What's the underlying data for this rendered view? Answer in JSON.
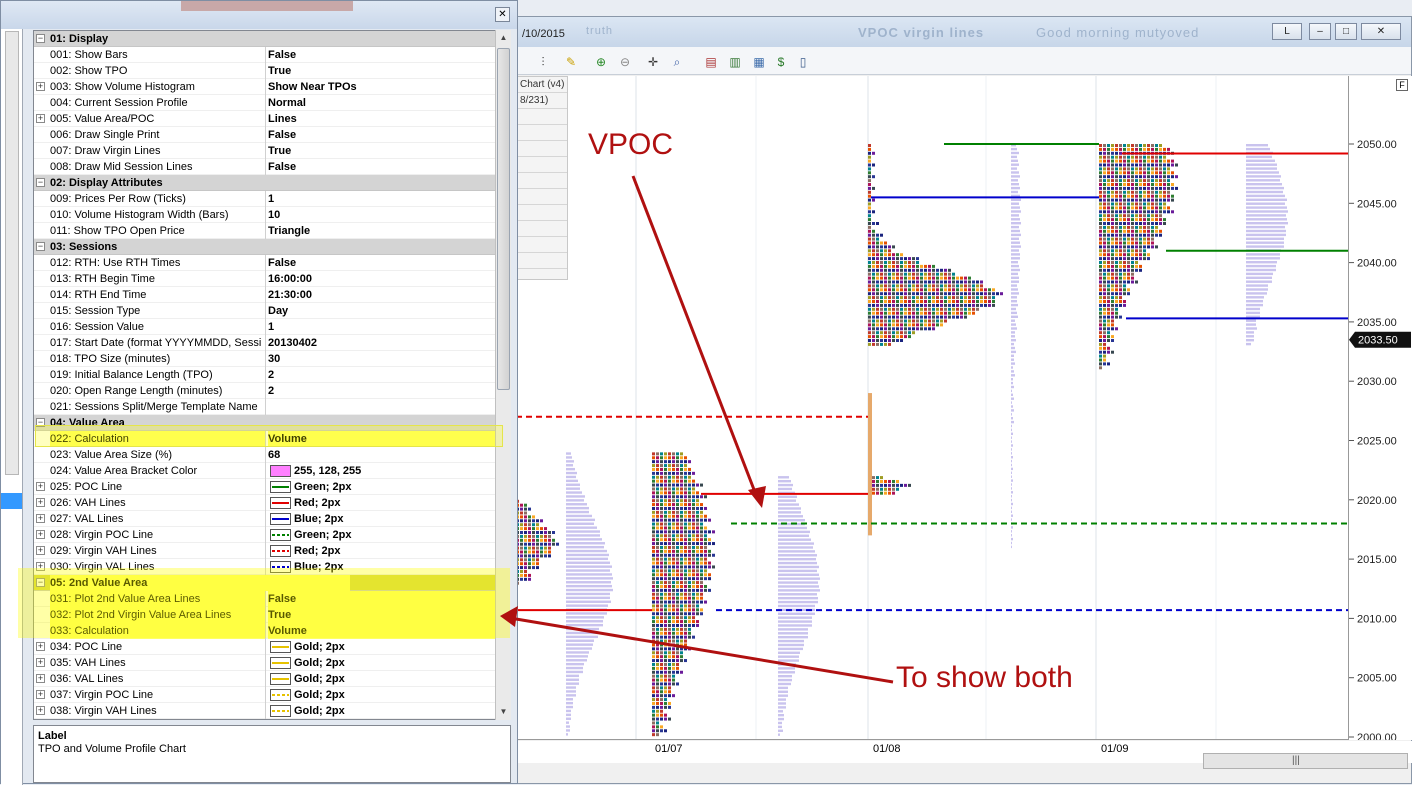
{
  "chart_window": {
    "date_fragment": "/10/2015",
    "title_blur": "VPOC virgin lines",
    "title_blur_extra": "Good morning mutyoved",
    "title_left_blur": "truth",
    "btn_l": "L",
    "btn_min": "–",
    "btn_max": "□",
    "btn_close": "✕",
    "f_button": "F",
    "info_panel": [
      "Chart (v4)",
      "8/231)",
      "",
      "",
      "",
      "",
      "",
      "",
      "",
      "",
      "",
      ""
    ],
    "price_axis": {
      "ticks": [
        "2050.00",
        "2045.00",
        "2040.00",
        "2035.00",
        "2030.00",
        "2025.00",
        "2020.00",
        "2015.00",
        "2010.00",
        "2005.00",
        "2000.00"
      ],
      "current_price": "2033.50"
    },
    "time_axis": [
      "01/07",
      "01/08",
      "01/09"
    ],
    "scroll_grip": "|||"
  },
  "properties": {
    "close_label": "✕",
    "rows": [
      {
        "type": "cat",
        "exp": "⊟",
        "name": "01: Display"
      },
      {
        "name": "001: Show Bars",
        "val": "False"
      },
      {
        "name": "002: Show TPO",
        "val": "True"
      },
      {
        "exp": "+",
        "name": "003: Show Volume Histogram",
        "val": "Show Near TPOs"
      },
      {
        "name": "004: Current Session Profile",
        "val": "Normal"
      },
      {
        "exp": "+",
        "name": "005: Value Area/POC",
        "val": "Lines"
      },
      {
        "name": "006: Draw Single Print",
        "val": "False"
      },
      {
        "name": "007: Draw Virgin Lines",
        "val": "True"
      },
      {
        "name": "008: Draw Mid Session Lines",
        "val": "False"
      },
      {
        "type": "cat",
        "exp": "⊟",
        "name": "02: Display Attributes"
      },
      {
        "name": "009: Prices Per Row (Ticks)",
        "val": "1"
      },
      {
        "name": "010: Volume Histogram Width (Bars)",
        "val": "10"
      },
      {
        "name": "011: Show TPO Open Price",
        "val": "Triangle"
      },
      {
        "type": "cat",
        "exp": "⊟",
        "name": "03: Sessions"
      },
      {
        "name": "012: RTH: Use RTH Times",
        "val": "False"
      },
      {
        "name": "013: RTH Begin Time",
        "val": "16:00:00"
      },
      {
        "name": "014: RTH End Time",
        "val": "21:30:00"
      },
      {
        "name": "015: Session Type",
        "val": "Day"
      },
      {
        "name": "016: Session Value",
        "val": "1"
      },
      {
        "name": "017: Start Date (format YYYYMMDD, Sessi",
        "val": "20130402"
      },
      {
        "name": "018: TPO Size (minutes)",
        "val": "30"
      },
      {
        "name": "019: Initial Balance Length (TPO)",
        "val": "2"
      },
      {
        "name": "020: Open Range Length (minutes)",
        "val": "2"
      },
      {
        "name": "021: Sessions Split/Merge Template Name",
        "val": ""
      },
      {
        "type": "cat",
        "exp": "⊟",
        "name": "04: Value Area"
      },
      {
        "name": "022: Calculation",
        "val": "Volume",
        "hl": true
      },
      {
        "name": "023: Value Area Size (%)",
        "val": "68"
      },
      {
        "name": "024: Value Area Bracket Color",
        "val": "255, 128, 255",
        "swatch": "#ff80ff",
        "fill": true
      },
      {
        "exp": "+",
        "name": "025: POC Line",
        "val": "Green; 2px",
        "swatch": "#008000"
      },
      {
        "exp": "+",
        "name": "026: VAH Lines",
        "val": "Red; 2px",
        "swatch": "#e00000"
      },
      {
        "exp": "+",
        "name": "027: VAL Lines",
        "val": "Blue; 2px",
        "swatch": "#0000cc"
      },
      {
        "exp": "+",
        "name": "028: Virgin POC Line",
        "val": "Green; 2px",
        "swatch": "#008000",
        "dashed": true
      },
      {
        "exp": "+",
        "name": "029: Virgin VAH Lines",
        "val": "Red; 2px",
        "swatch": "#e00000",
        "dashed": true
      },
      {
        "exp": "+",
        "name": "030: Virgin VAL Lines",
        "val": "Blue; 2px",
        "swatch": "#0000cc",
        "dashed": true
      },
      {
        "type": "cat",
        "exp": "⊟",
        "name": "05: 2nd Value Area",
        "hl": true
      },
      {
        "name": "031: Plot 2nd Value Area Lines",
        "val": "False",
        "hl": true
      },
      {
        "name": "032: Plot 2nd Virgin Value Area Lines",
        "val": "True",
        "hl": true
      },
      {
        "name": "033: Calculation",
        "val": "Volume",
        "hl": true
      },
      {
        "exp": "+",
        "name": "034: POC Line",
        "val": "Gold; 2px",
        "swatch": "#e6c200"
      },
      {
        "exp": "+",
        "name": "035: VAH Lines",
        "val": "Gold; 2px",
        "swatch": "#e6c200"
      },
      {
        "exp": "+",
        "name": "036: VAL Lines",
        "val": "Gold; 2px",
        "swatch": "#e6c200"
      },
      {
        "exp": "+",
        "name": "037: Virgin POC Line",
        "val": "Gold; 2px",
        "swatch": "#e6c200",
        "dashed": true
      },
      {
        "exp": "+",
        "name": "038: Virgin VAH Lines",
        "val": "Gold; 2px",
        "swatch": "#e6c200",
        "dashed": true
      }
    ],
    "description": {
      "title": "Label",
      "text": "TPO and Volume Profile Chart"
    }
  },
  "annotations": {
    "vpoc": "VPOC",
    "both": "To show both"
  },
  "colors": {
    "poc": "#008000",
    "vah": "#e00000",
    "val": "#0000cc",
    "annotation": "#b01010",
    "highlight": "#ffff66"
  }
}
